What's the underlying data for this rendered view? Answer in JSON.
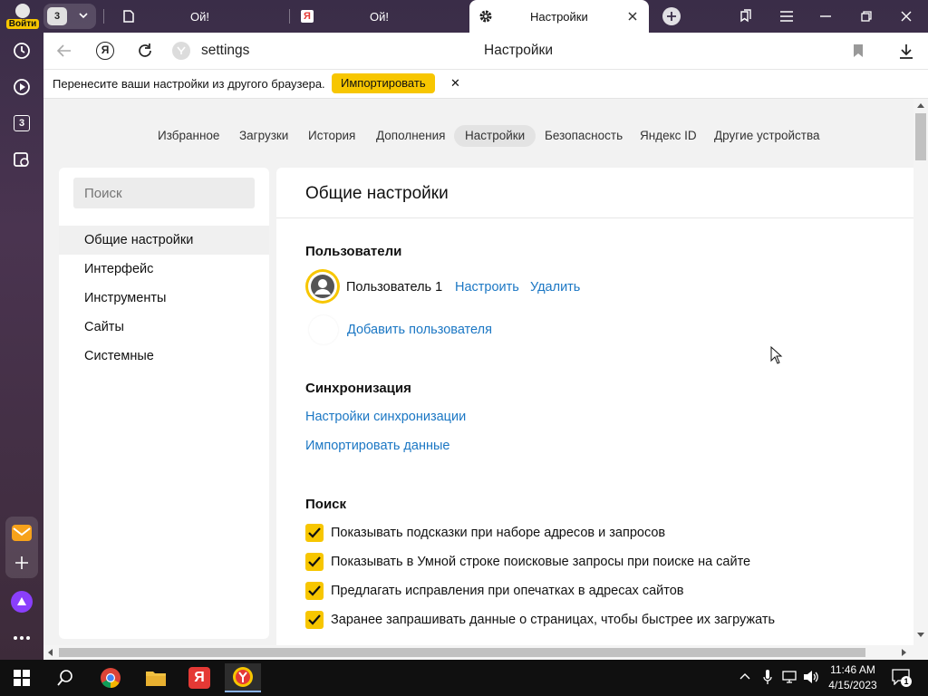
{
  "sidebar": {
    "login_label": "Войти",
    "tab_count": "3"
  },
  "tabs": {
    "group_count": "3",
    "items": [
      {
        "title": "Ой!"
      },
      {
        "title": "Ой!"
      },
      {
        "title": "Настройки"
      }
    ]
  },
  "address": {
    "url": "settings",
    "page_title": "Настройки"
  },
  "infobar": {
    "text": "Перенесите ваши настройки из другого браузера.",
    "import_label": "Импортировать",
    "close_glyph": "✕"
  },
  "topnav": [
    "Избранное",
    "Загрузки",
    "История",
    "Дополнения",
    "Настройки",
    "Безопасность",
    "Яндекс ID",
    "Другие устройства"
  ],
  "search": {
    "placeholder": "Поиск"
  },
  "leftmenu": [
    "Общие настройки",
    "Интерфейс",
    "Инструменты",
    "Сайты",
    "Системные"
  ],
  "main": {
    "title": "Общие настройки",
    "users": {
      "heading": "Пользователи",
      "user_name": "Пользователь 1",
      "configure": "Настроить",
      "delete": "Удалить",
      "add_user": "Добавить пользователя"
    },
    "sync": {
      "heading": "Синхронизация",
      "sync_settings": "Настройки синхронизации",
      "import_data": "Импортировать данные"
    },
    "search_section": {
      "heading": "Поиск",
      "options": [
        "Показывать подсказки при наборе адресов и запросов",
        "Показывать в Умной строке поисковые запросы при поиске на сайте",
        "Предлагать исправления при опечатках в адресах сайтов",
        "Заранее запрашивать данные о страницах, чтобы быстрее их загружать"
      ],
      "checked": [
        true,
        true,
        true,
        true
      ]
    }
  },
  "taskbar": {
    "time": "11:46 AM",
    "date": "4/15/2023",
    "notification_count": "1"
  },
  "colors": {
    "accent_yellow": "#f7c600",
    "link_blue": "#1b77c4",
    "chrome_purple": "#3a2d48"
  }
}
